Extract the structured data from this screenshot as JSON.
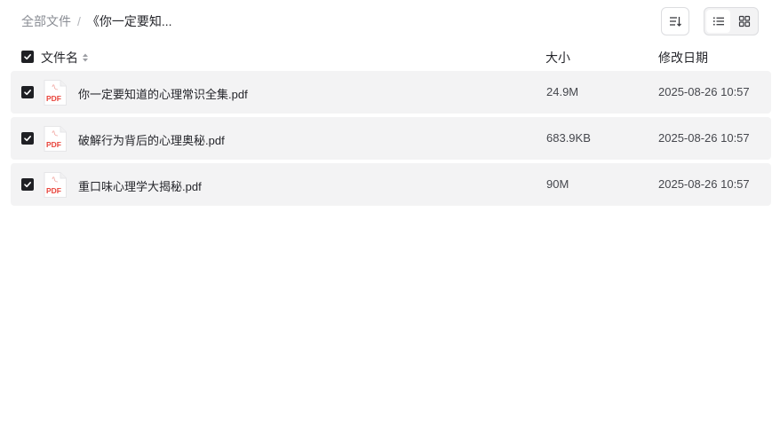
{
  "breadcrumb": {
    "root": "全部文件",
    "separator": "/",
    "current": "《你一定要知..."
  },
  "toolbar": {
    "sort_icon": "sort-icon",
    "view_list_icon": "list-view-icon",
    "view_grid_icon": "grid-view-icon",
    "active_view": "list"
  },
  "table": {
    "select_all_checked": true,
    "headers": {
      "name": "文件名",
      "size": "大小",
      "date": "修改日期"
    },
    "rows": [
      {
        "checked": true,
        "icon": "pdf-file-icon",
        "name": "你一定要知道的心理常识全集.pdf",
        "size": "24.9M",
        "date": "2025-08-26 10:57"
      },
      {
        "checked": true,
        "icon": "pdf-file-icon",
        "name": "破解行为背后的心理奥秘.pdf",
        "size": "683.9KB",
        "date": "2025-08-26 10:57"
      },
      {
        "checked": true,
        "icon": "pdf-file-icon",
        "name": "重口味心理学大揭秘.pdf",
        "size": "90M",
        "date": "2025-08-26 10:57"
      }
    ]
  },
  "file_icon_text": "PDF",
  "colors": {
    "row_background": "#f3f3f4",
    "checkbox": "#1f2024",
    "pdf_red": "#e8453c"
  }
}
